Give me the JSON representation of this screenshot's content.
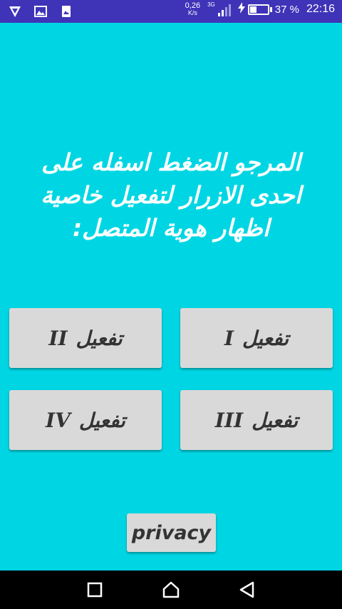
{
  "status_bar": {
    "net_speed_value": "0,26",
    "net_speed_unit": "K/s",
    "network_type": "3G",
    "battery_percent": "37 %",
    "battery_level": 0.37,
    "time": "22:16",
    "icons": [
      "vpn-shield-icon",
      "gallery-icon",
      "screenshot-icon",
      "signal-icon",
      "charging-icon",
      "battery-icon"
    ]
  },
  "main": {
    "message": "المرجو الضغط اسفله على احدى الازرار لتفعيل خاصية اظهار هوية المتصل:"
  },
  "buttons": [
    {
      "label": "تفعيل",
      "numeral": "I"
    },
    {
      "label": "تفعيل",
      "numeral": "II"
    },
    {
      "label": "تفعيل",
      "numeral": "III"
    },
    {
      "label": "تفعيل",
      "numeral": "IV"
    }
  ],
  "privacy_label": "privacy",
  "nav_bar": {
    "icons": [
      "recent-apps-icon",
      "home-icon",
      "back-icon"
    ]
  },
  "colors": {
    "background": "#00d6e3",
    "status_bar": "#3f33b8",
    "button": "#d9d9d9",
    "button_text": "#333333",
    "message_text": "#ffffff"
  }
}
